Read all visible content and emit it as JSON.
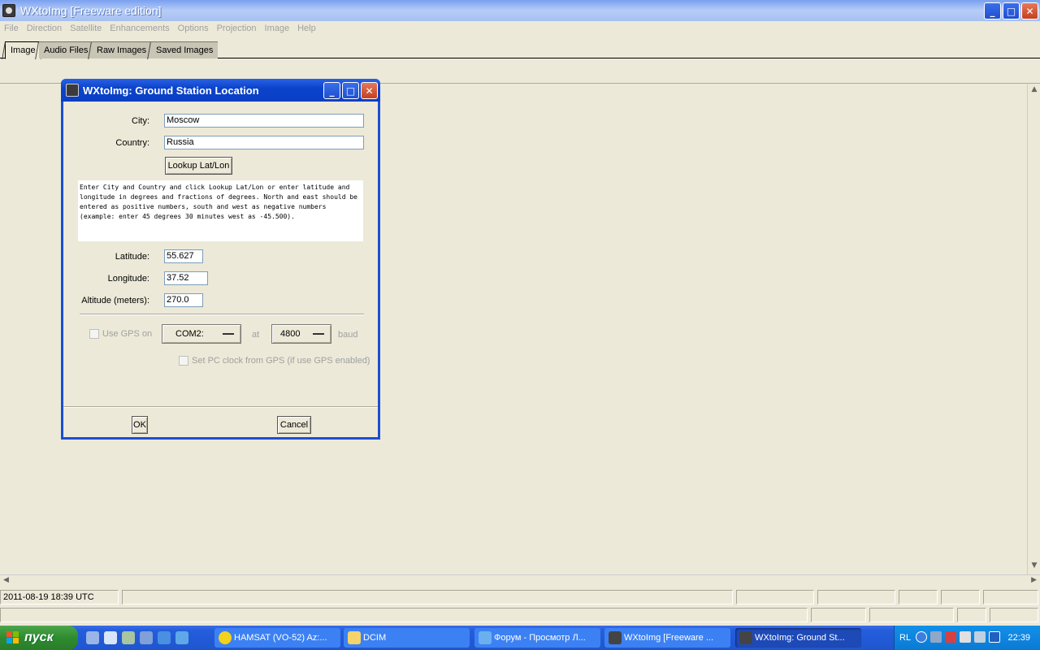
{
  "window": {
    "title": "WXtoImg [Freeware edition]",
    "controls": {
      "minimize": "_",
      "maximize": "□",
      "close": "✕"
    }
  },
  "menu": [
    "File",
    "Direction",
    "Satellite",
    "Enhancements",
    "Options",
    "Projection",
    "Image",
    "Help"
  ],
  "tabs": [
    "Image",
    "Audio Files",
    "Raw Images",
    "Saved Images"
  ],
  "status": {
    "datetime": "2011-08-19  18:39 UTC"
  },
  "dialog": {
    "title": "WXtoImg: Ground Station Location",
    "city_label": "City:",
    "city_value": "Moscow",
    "country_label": "Country:",
    "country_value": "Russia",
    "lookup_button": "Lookup Lat/Lon",
    "info_text": "Enter City and Country and click Lookup Lat/Lon or enter latitude and longitude in degrees and fractions of degrees.  North and east should be entered as positive numbers, south and west as negative numbers (example: enter 45 degrees 30 minutes west as -45.500).",
    "latitude_label": "Latitude:",
    "latitude_value": "55.627",
    "longitude_label": "Longitude:",
    "longitude_value": "37.52",
    "altitude_label": "Altitude (meters):",
    "altitude_value": "270.0",
    "use_gps_label": "Use GPS on",
    "port_value": "COM2:",
    "at_label": "at",
    "baud_value": "4800",
    "baud_label": "baud",
    "set_clock_label": "Set PC clock from GPS (if use GPS enabled)",
    "ok_button": "OK",
    "cancel_button": "Cancel"
  },
  "taskbar": {
    "start_label": "пуск",
    "tasks": [
      "HAMSAT (VO-52)  Az:...",
      "DCIM",
      "Форум - Просмотр Л...",
      "WXtoImg [Freeware ...",
      "WXtoImg: Ground St..."
    ],
    "language": "RL",
    "clock": "22:39"
  }
}
